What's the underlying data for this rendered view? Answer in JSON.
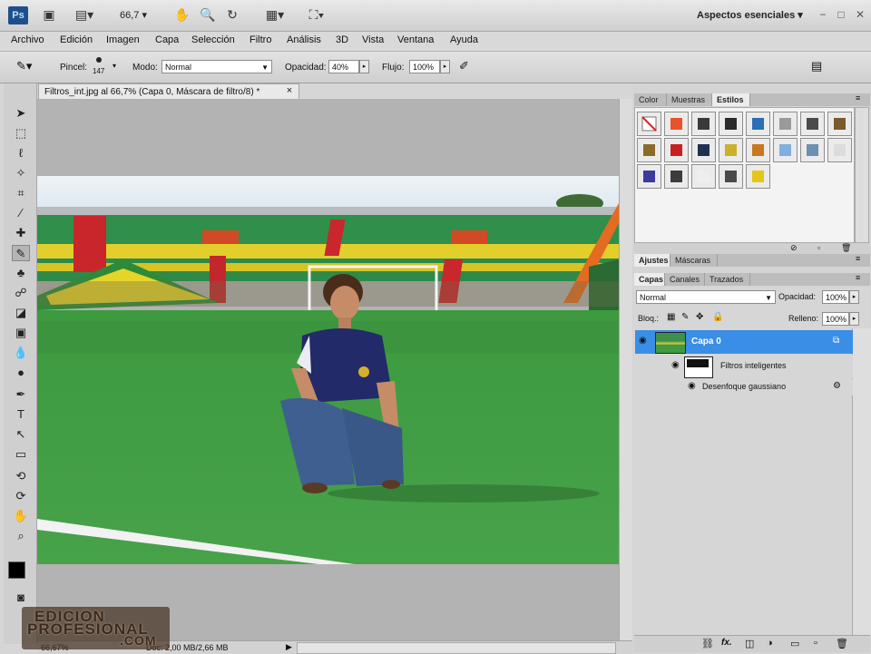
{
  "appbar": {
    "logo": "Ps",
    "zoom": "66,7",
    "workspace": "Aspectos esenciales",
    "icons": [
      "bridge-icon",
      "minibridge-icon",
      "view-extras-icon",
      "hand-icon",
      "zoom-icon",
      "rotate-icon",
      "arrange-icon",
      "screen-mode-icon"
    ],
    "window_buttons": [
      "−",
      "□",
      "✕"
    ]
  },
  "menu": [
    "Archivo",
    "Edición",
    "Imagen",
    "Capa",
    "Selección",
    "Filtro",
    "Análisis",
    "3D",
    "Vista",
    "Ventana",
    "Ayuda"
  ],
  "options": {
    "brush_label": "Pincel:",
    "brush_size": "147",
    "mode_label": "Modo:",
    "mode_value": "Normal",
    "opacity_label": "Opacidad:",
    "opacity_value": "40%",
    "flow_label": "Flujo:",
    "flow_value": "100%"
  },
  "document": {
    "tab_title": "Filtros_int.jpg al 66,7% (Capa 0, Máscara de filtro/8) *",
    "close": "×",
    "zoom_status": "66,67%",
    "doc_status": "Doc: 2,00 MB/2,66 MB"
  },
  "styles_panel": {
    "tabs": [
      "Color",
      "Muestras",
      "Estilos"
    ],
    "active_tab": "Estilos",
    "swatch_colors": [
      "#ffffff",
      "#e8532a",
      "#3a3a3a",
      "#2b2b2b",
      "#2a6fb3",
      "#9a9a9a",
      "#4a4a4a",
      "#7a5b2a",
      "#8b6a2a",
      "#c82020",
      "#203050",
      "#c9b22a",
      "#c8781e",
      "#7fb0e0",
      "#6c8fb2",
      "#dcdcdc",
      "#3b3b9e",
      "#3c3c3c",
      "#eeeeee",
      "#4a4a4a",
      "#e6c51a"
    ]
  },
  "adjust_panel": {
    "tabs": [
      "Ajustes",
      "Máscaras"
    ],
    "active_tab": "Ajustes"
  },
  "layers_panel": {
    "tabs": [
      "Capas",
      "Canales",
      "Trazados"
    ],
    "active_tab": "Capas",
    "blend_mode": "Normal",
    "opacity_label": "Opacidad:",
    "opacity_value": "100%",
    "lock_label": "Bloq.:",
    "fill_label": "Relleno:",
    "fill_value": "100%",
    "layer_name": "Capa 0",
    "smart_filters_label": "Filtros inteligentes",
    "filter_name": "Desenfoque gaussiano",
    "bottom_icons": [
      "link-icon",
      "fx-icon",
      "mask-icon",
      "adjustment-icon",
      "group-icon",
      "new-layer-icon",
      "trash-icon"
    ]
  },
  "watermark": {
    "line1": "EDICION",
    "line2": "PROFESIONAL",
    "line3": ".COM"
  }
}
